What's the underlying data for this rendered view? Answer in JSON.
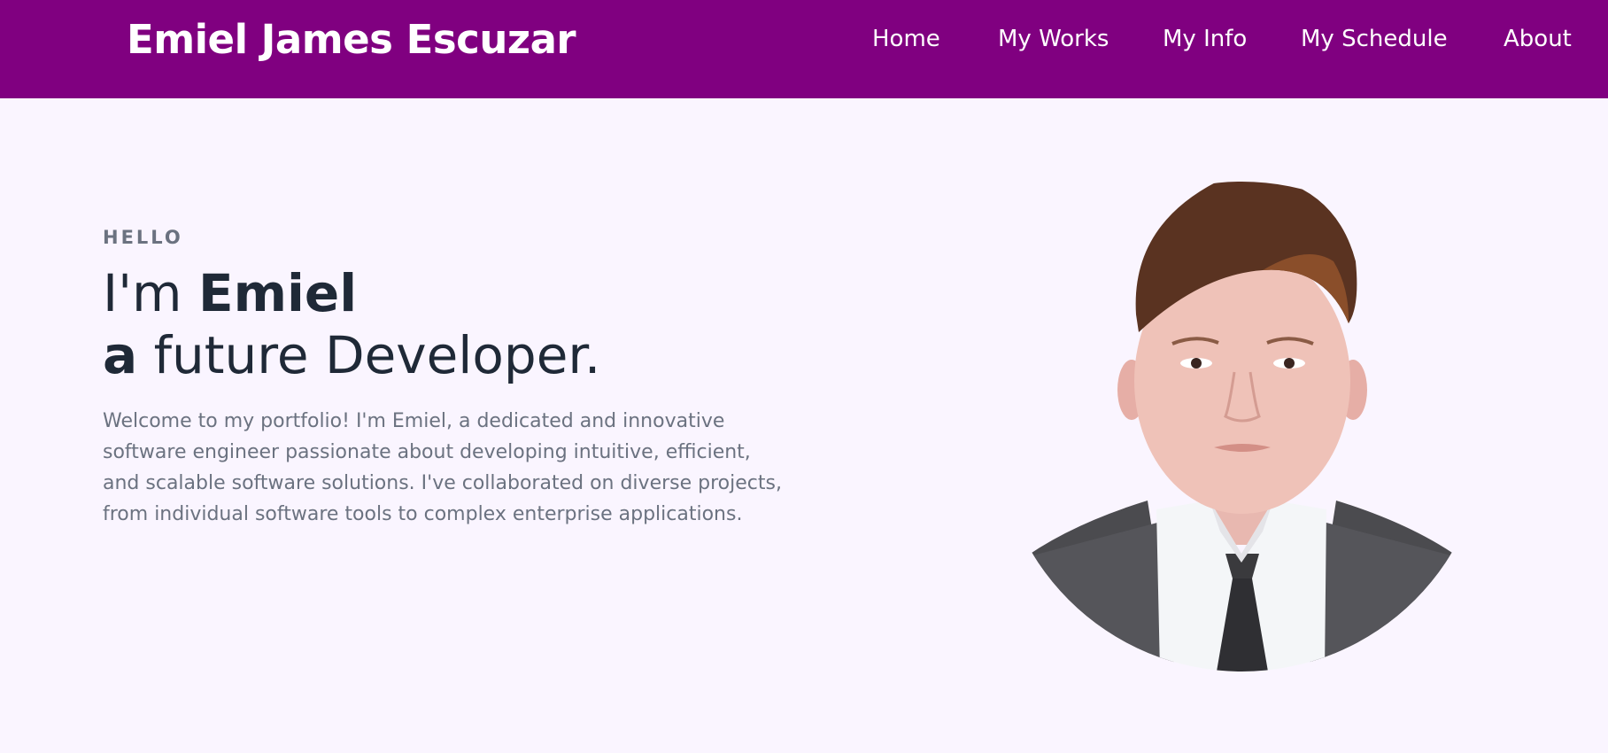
{
  "header": {
    "brand": "Emiel James Escuzar",
    "nav": [
      "Home",
      "My Works",
      "My Info",
      "My Schedule",
      "About"
    ]
  },
  "hero": {
    "kicker": "HELLO",
    "line1_prefix": "I'm ",
    "line1_name": "Emiel",
    "line2_bold": "a",
    "line2_rest": " future Developer.",
    "intro": "Welcome to my portfolio! I'm Emiel, a dedicated and innovative software engineer passionate about developing intuitive, efficient, and scalable software solutions. I've collaborated on diverse projects, from individual software tools to complex enterprise applications."
  },
  "colors": {
    "nav_bg": "#800080",
    "page_bg": "#faf5ff",
    "heading": "#1f2937",
    "body_text": "#6b7280"
  }
}
